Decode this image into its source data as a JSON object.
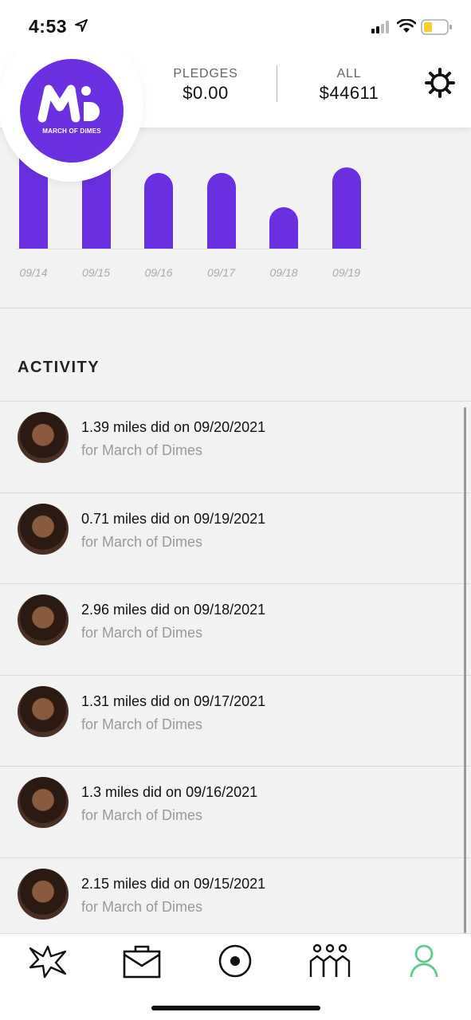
{
  "status_bar": {
    "time": "4:53"
  },
  "header": {
    "logo_text": "MARCH OF DIMES",
    "pledges": {
      "label": "PLEDGES",
      "value": "$0.00"
    },
    "all": {
      "label": "ALL",
      "value": "$44611"
    }
  },
  "chart_data": {
    "type": "bar",
    "categories": [
      "09/14",
      "09/15",
      "09/16",
      "09/17",
      "09/18",
      "09/19"
    ],
    "values": [
      2.2,
      2.15,
      1.3,
      1.31,
      0.71,
      1.4
    ],
    "note_visible_values": "only the bar heights are shown; no numeric axis is printed"
  },
  "activity": {
    "title": "ACTIVITY",
    "items": [
      {
        "title": "1.39 miles did on 09/20/2021",
        "subtitle": "for March of Dimes"
      },
      {
        "title": "0.71 miles did on 09/19/2021",
        "subtitle": "for March of Dimes"
      },
      {
        "title": "2.96 miles did on 09/18/2021",
        "subtitle": "for March of Dimes"
      },
      {
        "title": "1.31 miles did on 09/17/2021",
        "subtitle": "for March of Dimes"
      },
      {
        "title": "1.3 miles did on 09/16/2021",
        "subtitle": "for March of Dimes"
      },
      {
        "title": "2.15 miles did on 09/15/2021",
        "subtitle": "for March of Dimes"
      }
    ]
  },
  "tabbar": {
    "tabs": [
      {
        "icon": "burst-icon"
      },
      {
        "icon": "briefcase-icon"
      },
      {
        "icon": "record-icon"
      },
      {
        "icon": "team-icon"
      },
      {
        "icon": "profile-icon",
        "active": true
      }
    ],
    "active_color": "#5ecb8a"
  },
  "colors": {
    "brand": "#6a2fe0"
  }
}
